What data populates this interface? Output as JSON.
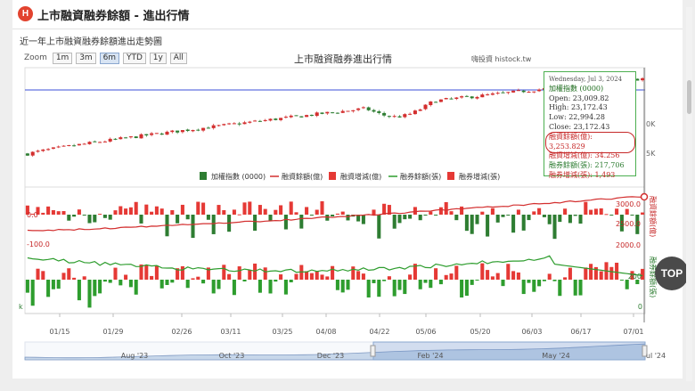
{
  "header": {
    "logo_text": "H",
    "title": "上市融資融券餘額 - 進出行情"
  },
  "subtitle": "近一年上市融資融券餘額進出走勢圖",
  "zoom": {
    "label": "Zoom",
    "buttons": [
      "1m",
      "3m",
      "6m",
      "YTD",
      "1y",
      "All"
    ],
    "selected": "6m"
  },
  "chart_title": "上市融資融券進出行情",
  "credit": "嗨投資 histock.tw",
  "legend": [
    "加權指數 (0000)",
    "融資餘額(億)",
    "融資增減(億)",
    "融券餘額(張)",
    "融券增減(張)"
  ],
  "colors": {
    "index_up": "#d32f2f",
    "index_down": "#2e7d32",
    "margin_line": "#d32f2f",
    "margin_bar": "#e53935",
    "short_line": "#2e9d2e",
    "short_bar_pos": "#e53935",
    "short_bar_neg": "#2e9d2e",
    "crosshair": "#3b4fd8",
    "navigator_fill": "#c7d7ea"
  },
  "axis_labels": {
    "pane2_left": [
      "0.0",
      "-100.0"
    ],
    "pane2_right": [
      "3000.0",
      "2500.0"
    ],
    "pane3_right": [
      "2000.0",
      "200",
      "0"
    ],
    "pane1_right": [
      "0K",
      "5K"
    ],
    "pane3_left": "k",
    "pane2_title": "融資餘額(億)",
    "pane3_title": "融券餘額(張)"
  },
  "x_ticks": [
    "01/15",
    "01/29",
    "02/26",
    "03/11",
    "03/25",
    "04/08",
    "04/22",
    "05/06",
    "05/20",
    "06/03",
    "06/17",
    "07/01"
  ],
  "navigator_ticks": [
    "Aug '23",
    "Oct '23",
    "Dec '23",
    "Feb '24",
    "May '24",
    "ul '24"
  ],
  "tooltip": {
    "date": "Wednesday, Jul 3, 2024",
    "name": "加權指數 (0000)",
    "open": "Open: 23,009.82",
    "high": "High: 23,172.43",
    "low": "Low: 22,994.28",
    "close": "Close: 23,172.43",
    "margin_balance": "融資餘額(億): 3,253.829",
    "margin_change": "融資增減(億): 34.256",
    "short_balance": "融券餘額(張): 217,706",
    "short_change": "融券增減(張): 1,493"
  },
  "top_button": "TOP",
  "chart_data": {
    "type": "candlestick+bar+line",
    "title": "上市融資融券進出行情",
    "x_range": [
      "2024-01-05",
      "2024-07-03"
    ],
    "series": [
      {
        "name": "加權指數 (0000)",
        "type": "candlestick",
        "start": 17400,
        "end": 23172.43,
        "last": {
          "open": 23009.82,
          "high": 23172.43,
          "low": 22994.28,
          "close": 23172.43
        }
      },
      {
        "name": "融資餘額(億)",
        "type": "line",
        "start": 2560,
        "end": 3253.829,
        "ylim": [
          2400,
          3300
        ]
      },
      {
        "name": "融資增減(億)",
        "type": "bar",
        "last": 34.256,
        "ylim": [
          -150,
          100
        ]
      },
      {
        "name": "融券餘額(張)",
        "type": "line",
        "last": 217706
      },
      {
        "name": "融券增減(張)",
        "type": "bar",
        "last": 1493
      }
    ]
  }
}
